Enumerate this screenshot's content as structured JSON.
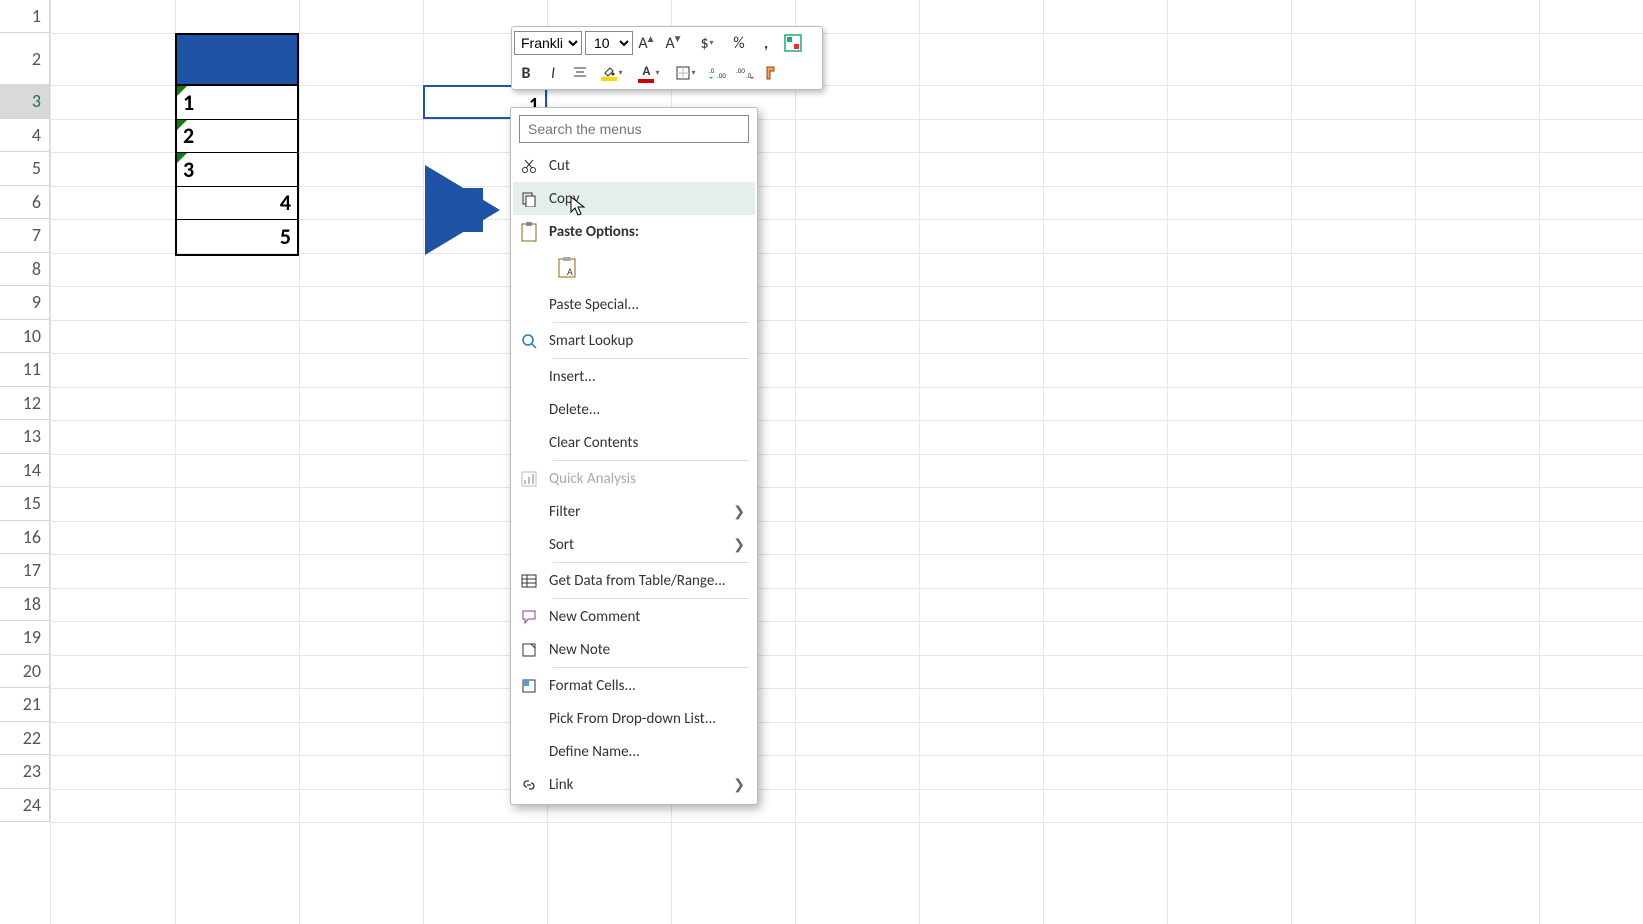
{
  "rows": [
    "1",
    "2",
    "3",
    "4",
    "5",
    "6",
    "7",
    "8",
    "9",
    "10",
    "11",
    "12",
    "13",
    "14",
    "15",
    "16",
    "17",
    "18",
    "19",
    "20",
    "21",
    "22",
    "23",
    "24"
  ],
  "active_row_index": 2,
  "table": {
    "cells": [
      {
        "value": "1",
        "align": "left",
        "green": true
      },
      {
        "value": "2",
        "align": "left",
        "green": true
      },
      {
        "value": "3",
        "align": "left",
        "green": true
      },
      {
        "value": "4",
        "align": "right",
        "green": false
      },
      {
        "value": "5",
        "align": "right",
        "green": false
      }
    ]
  },
  "selected_cell_value": "1",
  "mini_toolbar": {
    "font_name": "Franklin",
    "font_size": "10"
  },
  "menu": {
    "search_placeholder": "Search the menus",
    "cut": "Cut",
    "copy": "Copy",
    "paste_options": "Paste Options:",
    "paste_special": "Paste Special...",
    "smart_lookup": "Smart Lookup",
    "insert": "Insert...",
    "delete": "Delete...",
    "clear_contents": "Clear Contents",
    "quick_analysis": "Quick Analysis",
    "filter": "Filter",
    "sort": "Sort",
    "get_data": "Get Data from Table/Range...",
    "new_comment": "New Comment",
    "new_note": "New Note",
    "format_cells": "Format Cells...",
    "pick_list": "Pick From Drop-down List...",
    "define_name": "Define Name...",
    "link": "Link"
  },
  "colors": {
    "accent": "#1F53A6"
  }
}
